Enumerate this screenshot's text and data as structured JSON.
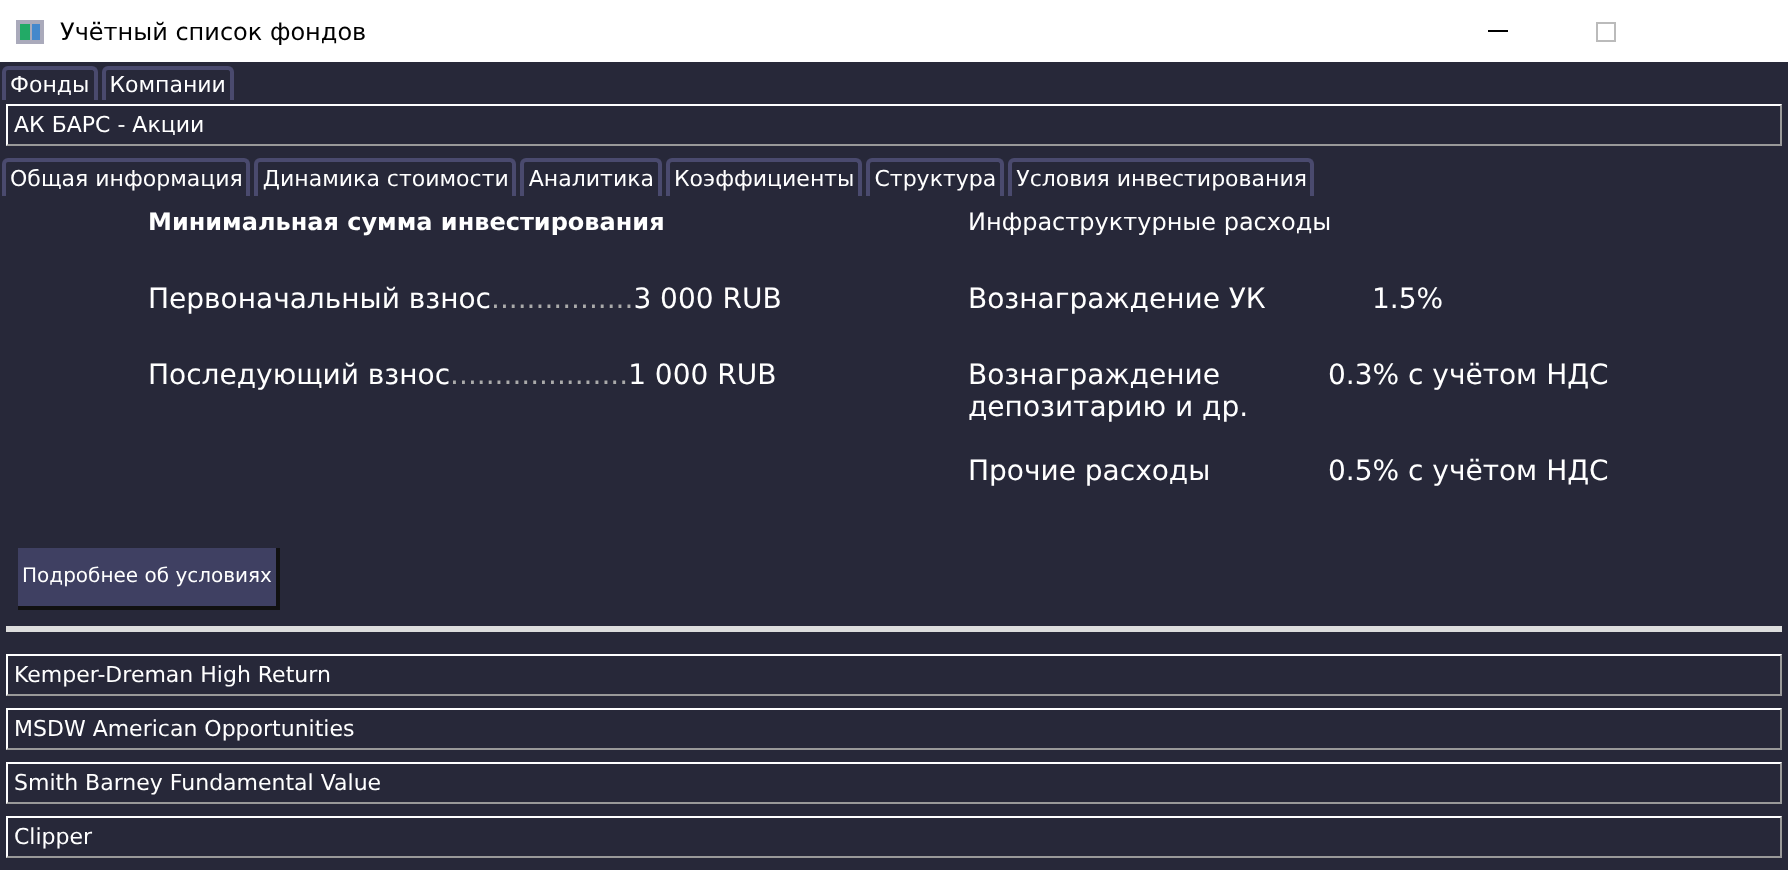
{
  "window": {
    "title": "Учётный список фондов"
  },
  "top_tabs": [
    {
      "label": "Фонды"
    },
    {
      "label": "Компании"
    }
  ],
  "fund_title": "АК БАРС - Акции",
  "tabs": [
    {
      "label": "Общая информация"
    },
    {
      "label": "Динамика стоимости"
    },
    {
      "label": "Аналитика"
    },
    {
      "label": "Коэффициенты"
    },
    {
      "label": "Структура"
    },
    {
      "label": "Условия инвестирования"
    }
  ],
  "minimum": {
    "heading": "Минимальная сумма инвестирования",
    "rows": [
      {
        "label": "Первоначальный взнос",
        "leader": "................",
        "value": "3 000 RUB"
      },
      {
        "label": "Последующий взнос",
        "leader": "....................",
        "value": "1 000 RUB"
      }
    ]
  },
  "expenses": {
    "heading": "Инфраструктурные расходы",
    "rows": [
      {
        "label": "Вознаграждение УК",
        "value": "1.5%"
      },
      {
        "label": "Вознаграждение депозитарию и др.",
        "value": "0.3% с учётом НДС"
      },
      {
        "label": "Прочие расходы",
        "value": "0.5% с учётом НДС"
      }
    ]
  },
  "details_button": "Подробнее об условиях",
  "funds": [
    "Kemper-Dreman High Return",
    "MSDW American Opportunities",
    "Smith Barney Fundamental Value",
    "Clipper"
  ]
}
